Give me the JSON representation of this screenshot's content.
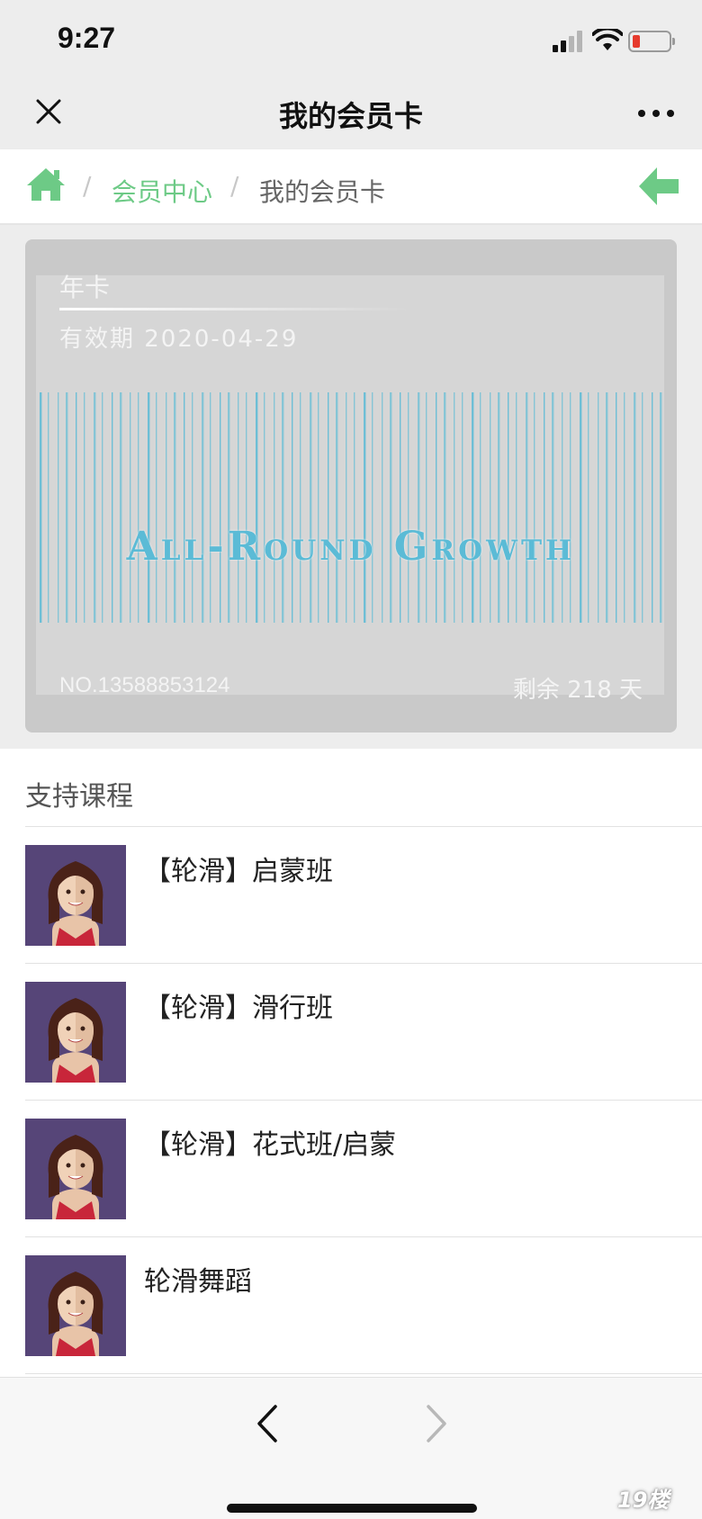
{
  "status_bar": {
    "time": "9:27"
  },
  "navbar": {
    "title": "我的会员卡"
  },
  "breadcrumb": {
    "separator": "/",
    "link": "会员中心",
    "current": "我的会员卡"
  },
  "card": {
    "type": "年卡",
    "validity": "有效期 2020-04-29",
    "logo_text": "All-Round Growth",
    "number": "NO.13588853124",
    "remaining": "剩余 218 天"
  },
  "courses": {
    "title": "支持课程",
    "items": [
      {
        "name": "【轮滑】启蒙班"
      },
      {
        "name": "【轮滑】滑行班"
      },
      {
        "name": "【轮滑】花式班/启蒙"
      },
      {
        "name": "轮滑舞蹈"
      }
    ]
  },
  "watermark": "19楼",
  "colors": {
    "accent": "#6dca86",
    "card_bg": "#c9c9c9",
    "barcode": "#5bbbd6",
    "avatar_bg": "#564578"
  },
  "icons": [
    "close-icon",
    "more-icon",
    "home-icon",
    "back-arrow-icon",
    "chevron-left-icon",
    "chevron-right-icon"
  ]
}
